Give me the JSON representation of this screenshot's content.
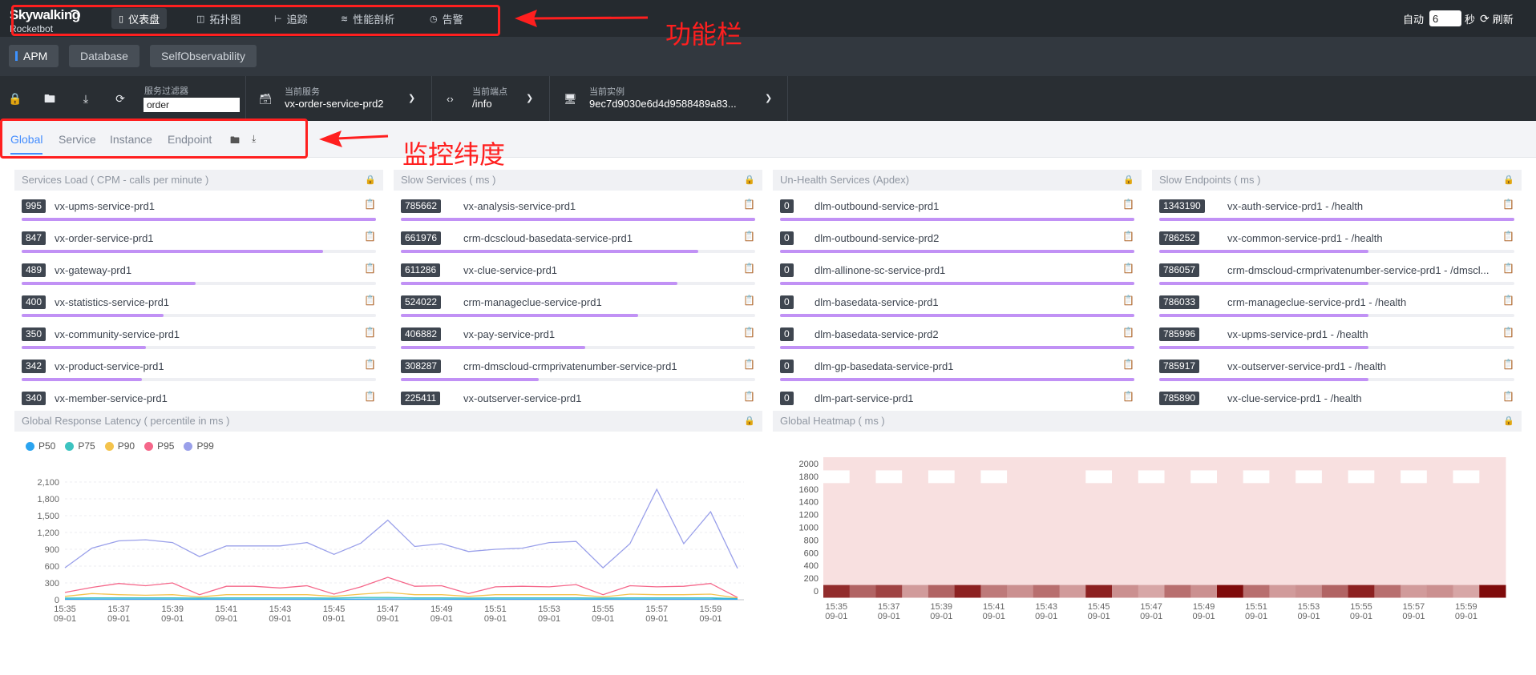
{
  "app": {
    "logo_line1": "Skywalking",
    "logo_line2": "Rocketbot"
  },
  "nav": [
    {
      "label": "仪表盘",
      "icon": "dashboard-icon",
      "active": true
    },
    {
      "label": "拓扑图",
      "icon": "topology-icon",
      "active": false
    },
    {
      "label": "追踪",
      "icon": "trace-icon",
      "active": false
    },
    {
      "label": "性能剖析",
      "icon": "profile-icon",
      "active": false
    },
    {
      "label": "告警",
      "icon": "alarm-icon",
      "active": false
    }
  ],
  "refresh": {
    "auto_label": "自动",
    "interval_value": "6",
    "unit_label": "秒",
    "refresh_label": "刷新"
  },
  "group_tabs": [
    {
      "label": "APM",
      "active": true
    },
    {
      "label": "Database",
      "active": false
    },
    {
      "label": "SelfObservability",
      "active": false
    }
  ],
  "toolbar": {
    "filter_label": "服务过滤器",
    "filter_value": "order",
    "service_label": "当前服务",
    "service_value": "vx-order-service-prd2",
    "endpoint_label": "当前端点",
    "endpoint_value": "/info",
    "instance_label": "当前实例",
    "instance_value": "9ec7d9030e6d4d9588489a83..."
  },
  "dimension_tabs": [
    {
      "label": "Global",
      "active": true
    },
    {
      "label": "Service",
      "active": false
    },
    {
      "label": "Instance",
      "active": false
    },
    {
      "label": "Endpoint",
      "active": false
    }
  ],
  "annotations": {
    "toolbar_note": "功能栏",
    "dimension_note": "监控纬度",
    "color": "#ff1f1f"
  },
  "panels": {
    "services_load": {
      "title": "Services Load ( CPM - calls per minute )",
      "items": [
        {
          "value": "995",
          "name": "vx-upms-service-prd1",
          "ratio": 1.0
        },
        {
          "value": "847",
          "name": "vx-order-service-prd1",
          "ratio": 0.85
        },
        {
          "value": "489",
          "name": "vx-gateway-prd1",
          "ratio": 0.49
        },
        {
          "value": "400",
          "name": "vx-statistics-service-prd1",
          "ratio": 0.4
        },
        {
          "value": "350",
          "name": "vx-community-service-prd1",
          "ratio": 0.35
        },
        {
          "value": "342",
          "name": "vx-product-service-prd1",
          "ratio": 0.34
        },
        {
          "value": "340",
          "name": "vx-member-service-prd1",
          "ratio": 0.34
        }
      ]
    },
    "slow_services": {
      "title": "Slow Services ( ms )",
      "items": [
        {
          "value": "785662",
          "name": "vx-analysis-service-prd1",
          "ratio": 1.0
        },
        {
          "value": "661976",
          "name": "crm-dcscloud-basedata-service-prd1",
          "ratio": 0.84
        },
        {
          "value": "611286",
          "name": "vx-clue-service-prd1",
          "ratio": 0.78
        },
        {
          "value": "524022",
          "name": "crm-manageclue-service-prd1",
          "ratio": 0.67
        },
        {
          "value": "406882",
          "name": "vx-pay-service-prd1",
          "ratio": 0.52
        },
        {
          "value": "308287",
          "name": "crm-dmscloud-crmprivatenumber-service-prd1",
          "ratio": 0.39
        },
        {
          "value": "225411",
          "name": "vx-outserver-service-prd1",
          "ratio": 0.29
        }
      ]
    },
    "unhealth_services": {
      "title": "Un-Health Services (Apdex)",
      "items": [
        {
          "value": "0",
          "name": "dlm-outbound-service-prd1",
          "ratio": 1.0
        },
        {
          "value": "0",
          "name": "dlm-outbound-service-prd2",
          "ratio": 1.0
        },
        {
          "value": "0",
          "name": "dlm-allinone-sc-service-prd1",
          "ratio": 1.0
        },
        {
          "value": "0",
          "name": "dlm-basedata-service-prd1",
          "ratio": 1.0
        },
        {
          "value": "0",
          "name": "dlm-basedata-service-prd2",
          "ratio": 1.0
        },
        {
          "value": "0",
          "name": "dlm-gp-basedata-service-prd1",
          "ratio": 1.0
        },
        {
          "value": "0",
          "name": "dlm-part-service-prd1",
          "ratio": 1.0
        }
      ]
    },
    "slow_endpoints": {
      "title": "Slow Endpoints ( ms )",
      "items": [
        {
          "value": "1343190",
          "name": "vx-auth-service-prd1 - /health",
          "ratio": 1.0
        },
        {
          "value": "786252",
          "name": "vx-common-service-prd1 - /health",
          "ratio": 0.59
        },
        {
          "value": "786057",
          "name": "crm-dmscloud-crmprivatenumber-service-prd1 - /dmscl...",
          "ratio": 0.59
        },
        {
          "value": "786033",
          "name": "crm-manageclue-service-prd1 - /health",
          "ratio": 0.59
        },
        {
          "value": "785996",
          "name": "vx-upms-service-prd1 - /health",
          "ratio": 0.59
        },
        {
          "value": "785917",
          "name": "vx-outserver-service-prd1 - /health",
          "ratio": 0.59
        },
        {
          "value": "785890",
          "name": "vx-clue-service-prd1 - /health",
          "ratio": 0.59
        }
      ]
    },
    "latency": {
      "title": "Global Response Latency ( percentile in ms )"
    },
    "heatmap": {
      "title": "Global Heatmap ( ms )"
    }
  },
  "chart_data": [
    {
      "type": "line",
      "title": "Global Response Latency ( percentile in ms )",
      "x": [
        "15:35",
        "15:36",
        "15:37",
        "15:38",
        "15:39",
        "15:40",
        "15:41",
        "15:42",
        "15:43",
        "15:44",
        "15:45",
        "15:46",
        "15:47",
        "15:48",
        "15:49",
        "15:50",
        "15:51",
        "15:52",
        "15:53",
        "15:54",
        "15:55",
        "15:56",
        "15:57",
        "15:58",
        "15:59",
        "16:00"
      ],
      "tick_labels": [
        "15:35",
        "15:37",
        "15:39",
        "15:41",
        "15:43",
        "15:45",
        "15:47",
        "15:49",
        "15:51",
        "15:53",
        "15:55",
        "15:57",
        "15:59"
      ],
      "tick_date": "09-01",
      "y_ticks": [
        0,
        300,
        600,
        900,
        1200,
        1500,
        1800,
        2100
      ],
      "y_tick_labels": [
        "0",
        "300",
        "600",
        "900",
        "1,200",
        "1,500",
        "1,800",
        "2,100"
      ],
      "ylim": [
        0,
        2100
      ],
      "legend_position": "top-left",
      "series": [
        {
          "name": "P50",
          "color": "#2ba4f0",
          "values": [
            10,
            12,
            12,
            12,
            12,
            10,
            12,
            12,
            12,
            12,
            10,
            12,
            14,
            12,
            12,
            10,
            12,
            12,
            12,
            12,
            10,
            12,
            12,
            12,
            12,
            10
          ]
        },
        {
          "name": "P75",
          "color": "#3dc3c0",
          "values": [
            30,
            35,
            35,
            35,
            35,
            30,
            35,
            35,
            35,
            35,
            30,
            40,
            40,
            35,
            35,
            30,
            35,
            35,
            35,
            35,
            30,
            35,
            35,
            35,
            35,
            20
          ]
        },
        {
          "name": "P90",
          "color": "#f4c34c",
          "values": [
            60,
            110,
            90,
            80,
            90,
            50,
            90,
            90,
            90,
            90,
            60,
            100,
            130,
            90,
            90,
            60,
            90,
            90,
            90,
            90,
            50,
            100,
            90,
            90,
            100,
            30
          ]
        },
        {
          "name": "P95",
          "color": "#f5678a",
          "values": [
            130,
            220,
            290,
            250,
            300,
            90,
            240,
            240,
            210,
            250,
            100,
            230,
            400,
            240,
            250,
            110,
            230,
            240,
            230,
            270,
            90,
            250,
            230,
            240,
            290,
            40
          ]
        },
        {
          "name": "P99",
          "color": "#9aa0ea",
          "values": [
            570,
            920,
            1050,
            1070,
            1020,
            770,
            960,
            960,
            960,
            1020,
            810,
            1010,
            1420,
            950,
            1000,
            860,
            900,
            920,
            1020,
            1040,
            570,
            1000,
            1970,
            1000,
            1570,
            560
          ]
        }
      ]
    },
    {
      "type": "heatmap",
      "title": "Global Heatmap ( ms )",
      "x": [
        "15:35",
        "15:36",
        "15:37",
        "15:38",
        "15:39",
        "15:40",
        "15:41",
        "15:42",
        "15:43",
        "15:44",
        "15:45",
        "15:46",
        "15:47",
        "15:48",
        "15:49",
        "15:50",
        "15:51",
        "15:52",
        "15:53",
        "15:54",
        "15:55",
        "15:56",
        "15:57",
        "15:58",
        "15:59",
        "16:00"
      ],
      "tick_labels": [
        "15:35",
        "15:37",
        "15:39",
        "15:41",
        "15:43",
        "15:45",
        "15:47",
        "15:49",
        "15:51",
        "15:53",
        "15:55",
        "15:57",
        "15:59"
      ],
      "tick_date": "09-01",
      "y_ticks": [
        0,
        200,
        400,
        600,
        800,
        1000,
        1200,
        1400,
        1600,
        1800,
        2000
      ],
      "bottom_row_intensity": [
        0.85,
        0.6,
        0.75,
        0.35,
        0.6,
        0.9,
        0.5,
        0.4,
        0.55,
        0.35,
        0.9,
        0.4,
        0.3,
        0.55,
        0.4,
        1.0,
        0.55,
        0.35,
        0.4,
        0.6,
        0.9,
        0.55,
        0.35,
        0.4,
        0.3,
        1.0
      ],
      "top_row_white": [
        0,
        2,
        4,
        6,
        10,
        12,
        14,
        16,
        18,
        20,
        22,
        24
      ],
      "color_low": "#fde9e9",
      "color_high": "#7f0b0b"
    }
  ]
}
